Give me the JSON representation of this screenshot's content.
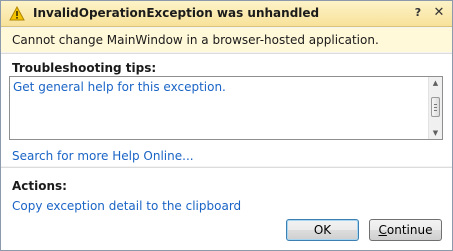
{
  "dialog": {
    "title": "InvalidOperationException was unhandled",
    "message": "Cannot change MainWindow in a browser-hosted application.",
    "help_glyph": "?",
    "close_glyph": "✕"
  },
  "tips": {
    "heading": "Troubleshooting tips:",
    "items": [
      "Get general help for this exception."
    ],
    "search_link": "Search for more Help Online..."
  },
  "actions": {
    "heading": "Actions:",
    "copy_link": "Copy exception detail to the clipboard"
  },
  "buttons": {
    "ok": "OK",
    "continue_first": "C",
    "continue_rest": "ontinue"
  },
  "scrollbar": {
    "up_glyph": "▲",
    "down_glyph": "▼"
  },
  "icons": {
    "title_icon": "warning-icon"
  },
  "colors": {
    "link": "#1a64c6",
    "title_band": "#f8e29a",
    "message_band": "#fff8d9"
  }
}
